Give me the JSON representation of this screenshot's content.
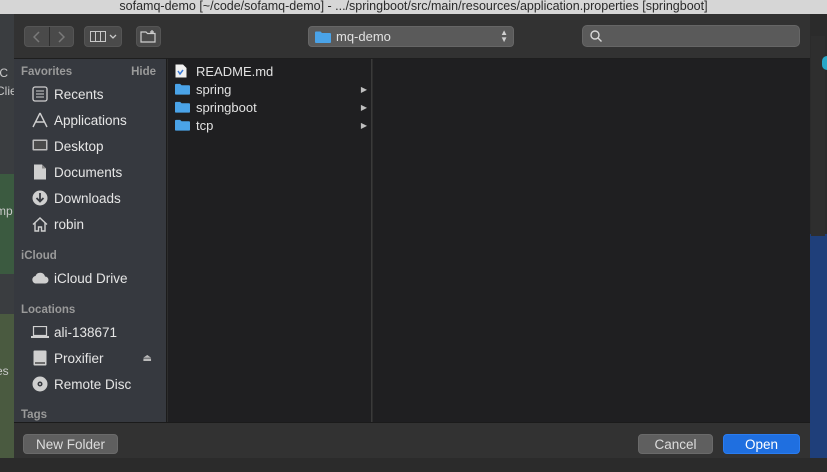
{
  "window": {
    "title": "sofamq-demo [~/code/sofamq-demo] - .../springboot/src/main/resources/application.properties [springboot]"
  },
  "background_fragments": [
    "IC",
    "Clie",
    "mp",
    "es"
  ],
  "toolbar": {
    "back_icon": "chevron-left-icon",
    "forward_icon": "chevron-right-icon",
    "view_icon": "columns-view-icon",
    "new_folder_icon": "folder-plus-icon",
    "path_popup": "mq-demo",
    "search_placeholder": ""
  },
  "sidebar": {
    "favorites_heading": "Favorites",
    "hide_label": "Hide",
    "favorites": [
      {
        "label": "Recents",
        "icon": "clock-icon"
      },
      {
        "label": "Applications",
        "icon": "applications-icon"
      },
      {
        "label": "Desktop",
        "icon": "desktop-icon"
      },
      {
        "label": "Documents",
        "icon": "documents-icon"
      },
      {
        "label": "Downloads",
        "icon": "downloads-icon"
      },
      {
        "label": "robin",
        "icon": "home-icon"
      }
    ],
    "icloud_heading": "iCloud",
    "icloud": [
      {
        "label": "iCloud Drive",
        "icon": "cloud-icon"
      }
    ],
    "locations_heading": "Locations",
    "locations": [
      {
        "label": "ali-138671",
        "icon": "laptop-icon"
      },
      {
        "label": "Proxifier",
        "icon": "drive-icon",
        "eject": true
      },
      {
        "label": "Remote Disc",
        "icon": "disc-icon"
      }
    ],
    "tags_heading": "Tags"
  },
  "browser": {
    "column1": [
      {
        "name": "README.md",
        "type": "file",
        "icon": "markdown-file-icon"
      },
      {
        "name": "spring",
        "type": "folder",
        "icon": "folder-icon"
      },
      {
        "name": "springboot",
        "type": "folder",
        "icon": "folder-icon"
      },
      {
        "name": "tcp",
        "type": "folder",
        "icon": "folder-icon"
      }
    ]
  },
  "footer": {
    "new_folder_label": "New Folder",
    "cancel_label": "Cancel",
    "open_label": "Open"
  },
  "colors": {
    "accent": "#1f6fe0",
    "folder": "#4aa3e8",
    "sidebar_bg": "#36393f",
    "browser_bg": "#1f1f21"
  }
}
